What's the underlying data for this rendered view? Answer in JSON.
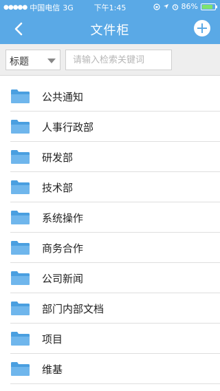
{
  "status_bar": {
    "signal_dots": "●●●●●",
    "carrier": "中国电信",
    "network": "3G",
    "time": "下午1:45",
    "battery_percent": "86%",
    "battery_level": 0.86
  },
  "nav": {
    "title": "文件柜",
    "back_icon": "chevron-left-icon",
    "add_icon": "plus-circle-icon"
  },
  "search": {
    "field_value": "标题",
    "placeholder": "请输入检索关键词"
  },
  "folders": [
    {
      "label": "公共通知"
    },
    {
      "label": "人事行政部"
    },
    {
      "label": "研发部"
    },
    {
      "label": "技术部"
    },
    {
      "label": "系统操作"
    },
    {
      "label": "商务合作"
    },
    {
      "label": "公司新闻"
    },
    {
      "label": "部门内部文档"
    },
    {
      "label": "项目"
    },
    {
      "label": "维基"
    }
  ],
  "colors": {
    "header": "#5aa9e6",
    "folder": "#4a9fe0",
    "battery": "#7ee36e"
  }
}
